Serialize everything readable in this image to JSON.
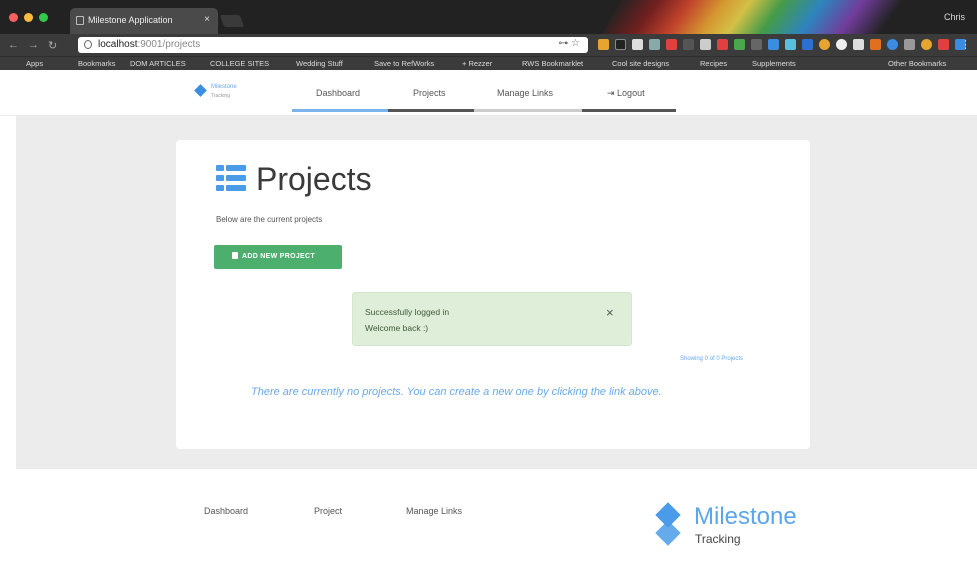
{
  "browser": {
    "tab_title": "Milestone Application",
    "tab_close": "×",
    "user": "Chris",
    "url_host": "localhost",
    "url_path": ":9001/projects",
    "bookmarks": [
      "Apps",
      "Bookmarks",
      "DOM ARTICLES",
      "COLLEGE SITES",
      "Wedding Stuff",
      "Save to RefWorks",
      "+ Rezzer",
      "RWS Bookmarklet",
      "Cool site designs",
      "Recipes",
      "Supplements",
      "Other Bookmarks"
    ]
  },
  "nav": {
    "logo_line1": "Milestone",
    "logo_line2": "Tracking",
    "items": [
      "Dashboard",
      "Projects",
      "Manage Links",
      "Logout"
    ]
  },
  "main": {
    "title": "Projects",
    "subtitle": "Below are the current projects",
    "add_button": "ADD NEW PROJECT",
    "alert_line1": "Successfully logged in",
    "alert_line2": "Welcome back :)",
    "alert_close": "×",
    "showing": "Showing 0 of 0 Projects",
    "empty_message": "There are currently no projects. You can create a new one by clicking the link above."
  },
  "footer": {
    "links": [
      "Dashboard",
      "Project",
      "Manage Links"
    ],
    "logo_word1": "Milestone",
    "logo_word2": "Tracking"
  },
  "colors": {
    "accent": "#4a9be8",
    "success": "#4caf6e",
    "alert_bg": "#dfeed8",
    "page_bg": "#ececec"
  }
}
